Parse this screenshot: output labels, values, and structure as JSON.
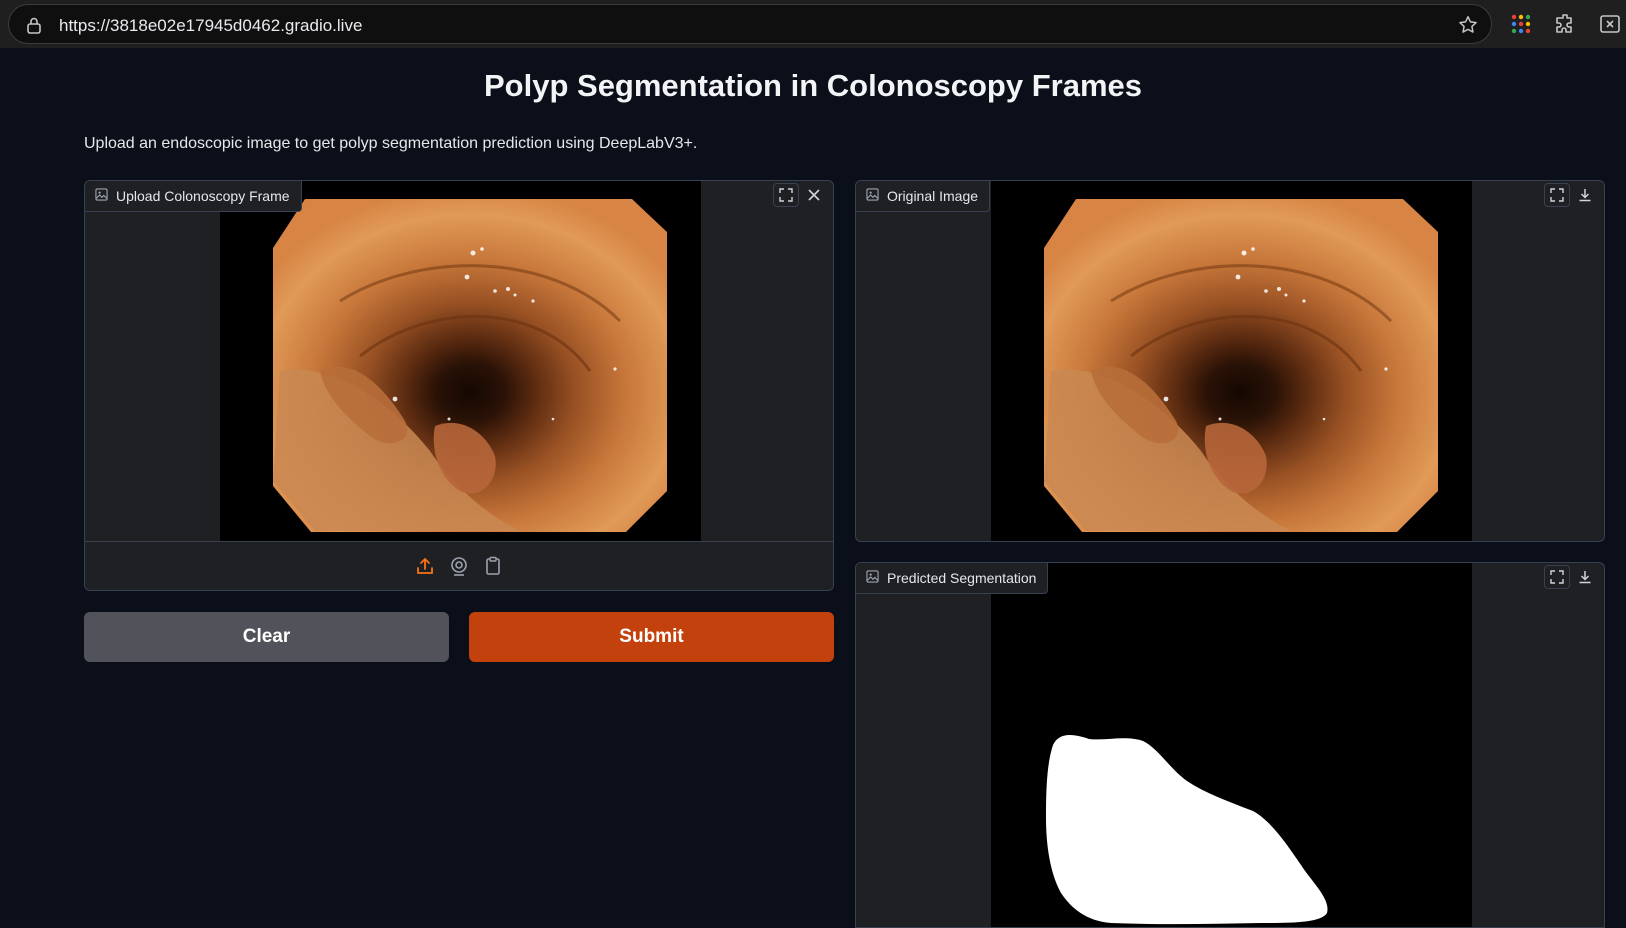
{
  "browser": {
    "url": "https://3818e02e17945d0462.gradio.live",
    "icons": [
      "lock-icon",
      "star-icon",
      "apps-icon",
      "extensions-icon",
      "tab-capture-icon"
    ]
  },
  "page": {
    "title": "Polyp Segmentation in Colonoscopy Frames",
    "description": "Upload an endoscopic image to get polyp segmentation prediction using DeepLabV3+."
  },
  "input_panel": {
    "label": "Upload Colonoscopy Frame",
    "tools": [
      "fullscreen-icon",
      "close-icon"
    ],
    "sources": [
      "upload-icon",
      "webcam-icon",
      "clipboard-icon"
    ]
  },
  "buttons": {
    "clear": "Clear",
    "submit": "Submit"
  },
  "output_original": {
    "label": "Original Image",
    "tools": [
      "fullscreen-icon",
      "download-icon"
    ]
  },
  "output_segmentation": {
    "label": "Predicted Segmentation",
    "tools": [
      "fullscreen-icon",
      "download-icon"
    ]
  },
  "colors": {
    "accent": "#c2410c",
    "background": "#0b0f19",
    "panel": "#1f2023",
    "clear_button": "#52535a",
    "upload_icon_active": "#f97316"
  }
}
